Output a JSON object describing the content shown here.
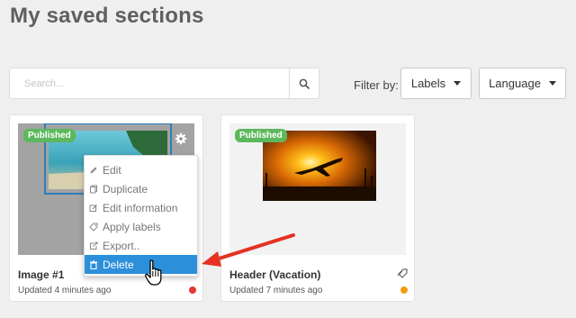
{
  "page": {
    "title": "My saved sections"
  },
  "search": {
    "placeholder": "Search..."
  },
  "filters": {
    "label": "Filter by:",
    "labels_button": "Labels",
    "language_button": "Language"
  },
  "cards": [
    {
      "badge": "Published",
      "title": "Image #1",
      "updated": "Updated 4 minutes ago",
      "status_color": "#e53935"
    },
    {
      "badge": "Published",
      "title": "Header (Vacation)",
      "updated": "Updated 7 minutes ago",
      "status_color": "#f39c12"
    }
  ],
  "context_menu": {
    "items": [
      {
        "label": "Edit",
        "icon": "pencil-icon"
      },
      {
        "label": "Duplicate",
        "icon": "copy-icon"
      },
      {
        "label": "Edit information",
        "icon": "edit-box-icon"
      },
      {
        "label": "Apply labels",
        "icon": "tag-icon"
      },
      {
        "label": "Export..",
        "icon": "export-icon"
      },
      {
        "label": "Delete",
        "icon": "trash-icon",
        "highlighted": true
      }
    ]
  },
  "colors": {
    "published_badge": "#5cb85c",
    "menu_highlight": "#2b8fd9",
    "annotation_arrow": "#e53222"
  }
}
